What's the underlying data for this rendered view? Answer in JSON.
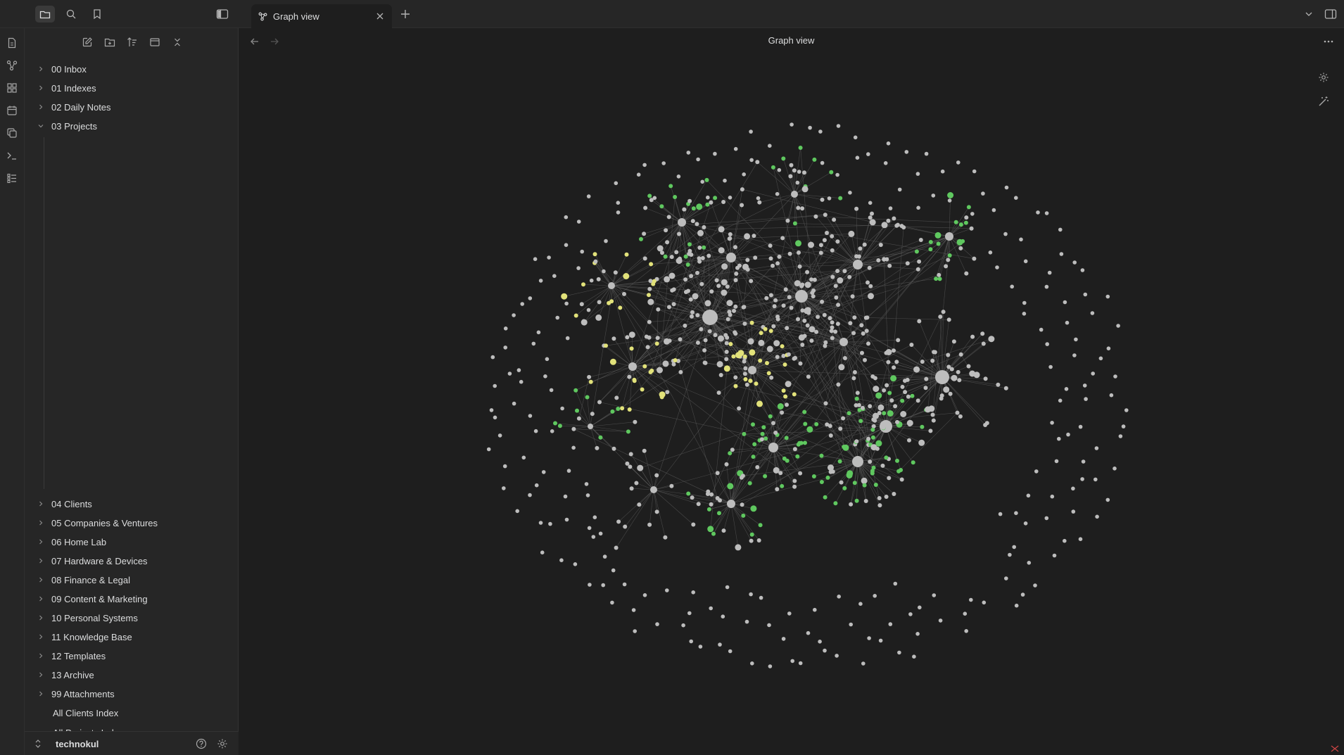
{
  "titlebar": {
    "buttons": [
      {
        "name": "folder-icon",
        "active": true
      },
      {
        "name": "search-icon",
        "active": false
      },
      {
        "name": "bookmark-icon",
        "active": false
      }
    ],
    "tab": {
      "title": "Graph view",
      "icon": "graph-icon"
    },
    "right_icons": [
      "chevron-down-icon",
      "sidebar-right-icon"
    ]
  },
  "ribbon": [
    "file-icon",
    "graph-icon",
    "canvas-icon",
    "calendar-icon",
    "copy-icon",
    "terminal-icon",
    "list-icon"
  ],
  "sidebar": {
    "nav_actions": [
      "new-note-icon",
      "new-folder-icon",
      "sort-icon",
      "collapse-icon",
      "close-all-icon"
    ],
    "folders": [
      {
        "label": "00 Inbox",
        "expanded": false
      },
      {
        "label": "01 Indexes",
        "expanded": false
      },
      {
        "label": "02 Daily Notes",
        "expanded": false
      },
      {
        "label": "03 Projects",
        "expanded": true
      },
      {
        "label": "04 Clients",
        "expanded": false
      },
      {
        "label": "05 Companies & Ventures",
        "expanded": false
      },
      {
        "label": "06 Home Lab",
        "expanded": false
      },
      {
        "label": "07 Hardware & Devices",
        "expanded": false
      },
      {
        "label": "08 Finance & Legal",
        "expanded": false
      },
      {
        "label": "09 Content & Marketing",
        "expanded": false
      },
      {
        "label": "10 Personal Systems",
        "expanded": false
      },
      {
        "label": "11 Knowledge Base",
        "expanded": false
      },
      {
        "label": "12 Templates",
        "expanded": false
      },
      {
        "label": "13 Archive",
        "expanded": false
      },
      {
        "label": "99 Attachments",
        "expanded": false
      }
    ],
    "files": [
      "All Clients Index",
      "All Projects Index"
    ],
    "footer": {
      "vault": "technokul",
      "help_icon": "help-icon",
      "settings_icon": "gear-icon"
    }
  },
  "main": {
    "title": "Graph view",
    "controls": [
      "graph-settings-icon",
      "animate-icon"
    ],
    "nav": [
      "back-arrow-icon",
      "forward-arrow-icon"
    ],
    "more_icon": "more-options-icon"
  },
  "colors": {
    "node": "#bdbdbd",
    "node_green": "#5fc85f",
    "node_yellow": "#e2e27a",
    "edge": "#5a5a5a",
    "accent_bg": "#3a3a3a"
  }
}
